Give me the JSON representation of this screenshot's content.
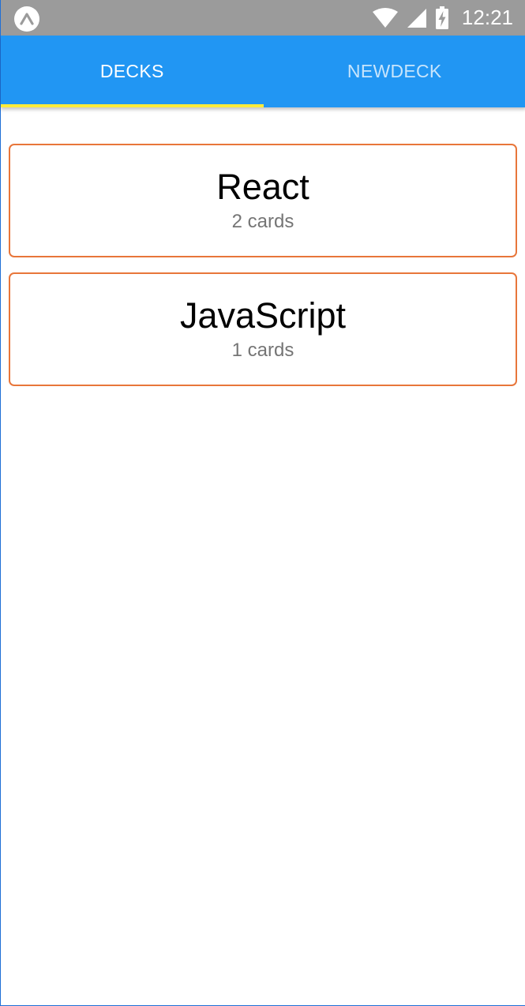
{
  "status_bar": {
    "time": "12:21",
    "icons": [
      "expo-icon",
      "wifi-icon",
      "cell-signal-icon",
      "battery-charging-icon"
    ]
  },
  "tabs": [
    {
      "label": "DECKS",
      "active": true
    },
    {
      "label": "NEWDECK",
      "active": false
    }
  ],
  "decks": [
    {
      "title": "React",
      "count_label": "2 cards"
    },
    {
      "title": "JavaScript",
      "count_label": "1 cards"
    }
  ],
  "colors": {
    "status_bar": "#9b9b9b",
    "tab_bar": "#2196f3",
    "tab_indicator": "#ffeb3b",
    "card_border": "#e8763a",
    "count_text": "#757575"
  }
}
